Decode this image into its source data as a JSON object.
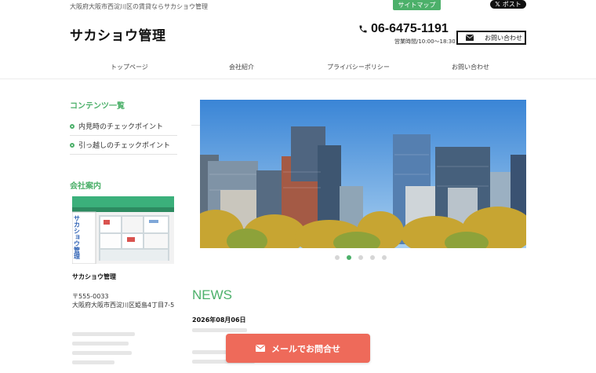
{
  "header": {
    "tagline": "大阪府大阪市西淀川区の賃貸ならサカショウ管理",
    "sitemap_label": "サイトマップ",
    "xpost_label": "ポスト",
    "xpost_logo": "𝕏",
    "brand": "サカショウ管理",
    "phone": "06-6475-1191",
    "hours": "営業時間/10:00〜18:30",
    "contact_label": "お問い合わせ"
  },
  "nav": {
    "items": [
      {
        "label": "トップページ"
      },
      {
        "label": "会社紹介"
      },
      {
        "label": "プライバシーポリシー"
      },
      {
        "label": "お問い合わせ"
      }
    ]
  },
  "sidebar": {
    "contents_heading": "コンテンツ一覧",
    "contents": [
      {
        "label": "内見時のチェックポイント"
      },
      {
        "label": "引っ越しのチェックポイント"
      }
    ],
    "company_heading": "会社案内",
    "shop_sign": "サカショウ管理",
    "company_name": "サカショウ管理",
    "postal": "〒555-0033",
    "address": "大阪府大阪市西淀川区姫島4丁目7-5"
  },
  "slider": {
    "dot_count": 5,
    "active_index": 1
  },
  "news": {
    "heading": "NEWS",
    "date": "2026年08月06日"
  },
  "cta": {
    "mail_label": "メールでお問合せ"
  },
  "colors": {
    "accent": "#4cb06a",
    "cta": "#ee6a5a"
  },
  "icons": {
    "phone": "phone-icon",
    "envelope": "envelope-icon"
  }
}
